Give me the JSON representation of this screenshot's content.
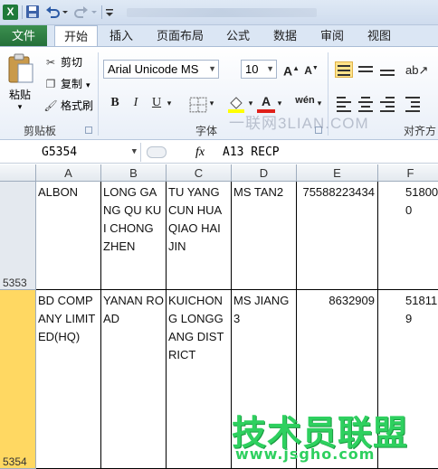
{
  "ribbon": {
    "tabs": [
      "文件",
      "开始",
      "插入",
      "页面布局",
      "公式",
      "数据",
      "审阅",
      "视图"
    ],
    "clipboard": {
      "paste_label": "粘贴",
      "cut_label": "剪切",
      "copy_label": "复制",
      "format_painter_label": "格式刷",
      "group_label": "剪贴板"
    },
    "font": {
      "font_name": "Arial Unicode MS",
      "font_size": "10",
      "group_label": "字体",
      "bold": "B",
      "italic": "I",
      "underline": "U",
      "font_color_glyph": "A",
      "wen_glyph": "wén"
    },
    "alignment": {
      "group_label": "对齐方"
    },
    "watermark_small": "一联网3LIAN.COM"
  },
  "formula_bar": {
    "name_box": "G5354",
    "fx": "fx",
    "value": "A13 RECP"
  },
  "grid": {
    "columns": [
      "A",
      "B",
      "C",
      "D",
      "E",
      "F"
    ],
    "rows": [
      {
        "row_number": "5353",
        "cells": [
          "ALBON",
          "LONG GANG QU KUI CHONG ZHEN",
          "TU YANG CUN HUA QIAO HAI JIN",
          "MS TAN2",
          "75588223434",
          "518000"
        ]
      },
      {
        "row_number": "5354",
        "cells": [
          "BD COMPANY LIMITED(HQ)",
          "YANAN ROAD",
          "KUICHONG LONGGANG DISTRICT",
          "MS JIANG3",
          "8632909",
          "518119"
        ]
      }
    ]
  },
  "watermark": {
    "brand": "技术员联盟",
    "url": "www.jsgho.com"
  }
}
